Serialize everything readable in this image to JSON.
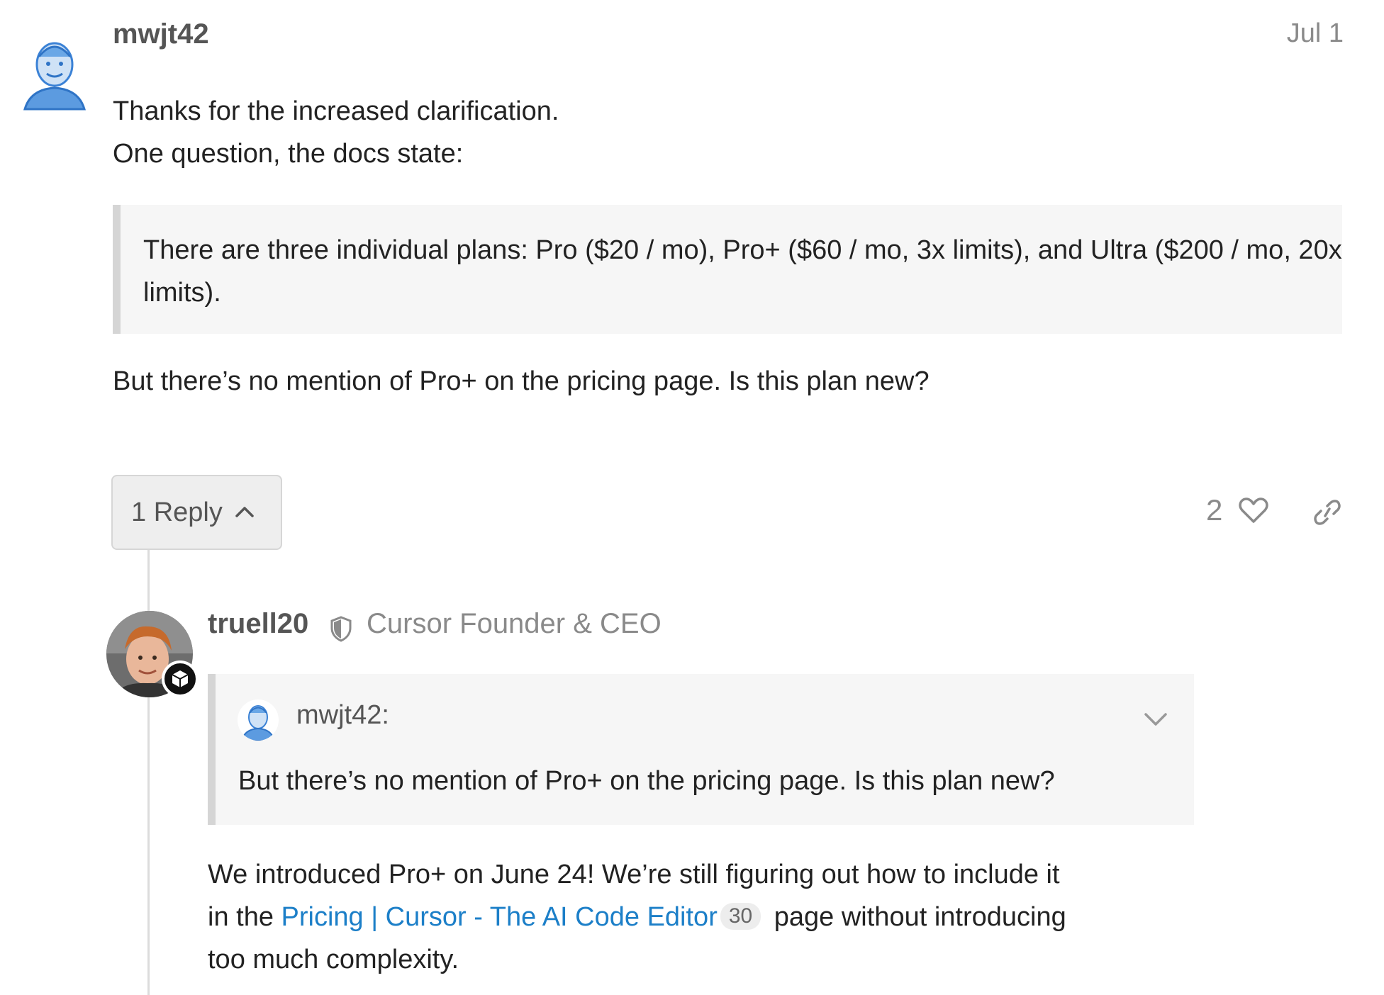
{
  "post": {
    "username": "mwjt42",
    "date": "Jul 1",
    "lines": [
      "Thanks for the increased clarification.",
      "One question, the docs state:"
    ],
    "quote": "There are three individual plans: Pro ($20 / mo), Pro+ ($60 / mo, 3x limits), and Ultra ($200 / mo, 20x limits).",
    "after_quote": "But there’s no mention of Pro+ on the pricing page. Is this plan new?",
    "reply_button": "1 Reply",
    "likes": "2"
  },
  "reply": {
    "username": "truell20",
    "title": "Cursor Founder & CEO",
    "quoted_user": "mwjt42:",
    "quoted_text": "But there’s no mention of Pro+ on the pricing page. Is this plan new?",
    "text_line1": "We introduced Pro+ on June 24! We’re still figuring out how to include it",
    "text_line2_before": "in the ",
    "link_text": "Pricing | Cursor - The AI Code Editor",
    "link_clicks": "30",
    "text_line2_after": " page without introducing",
    "text_line3": "too much complexity."
  },
  "icons": {
    "reply_chevron": "chevron-up-icon",
    "like": "heart-icon",
    "share": "link-icon",
    "flair": "shield-icon",
    "moderator": "cube-icon",
    "expand_quote": "chevron-down-icon"
  },
  "colors": {
    "link": "#1c7fc8",
    "muted_text": "#8a8a8a",
    "quote_bg": "#f6f6f6",
    "quote_border": "#d5d5d5"
  }
}
